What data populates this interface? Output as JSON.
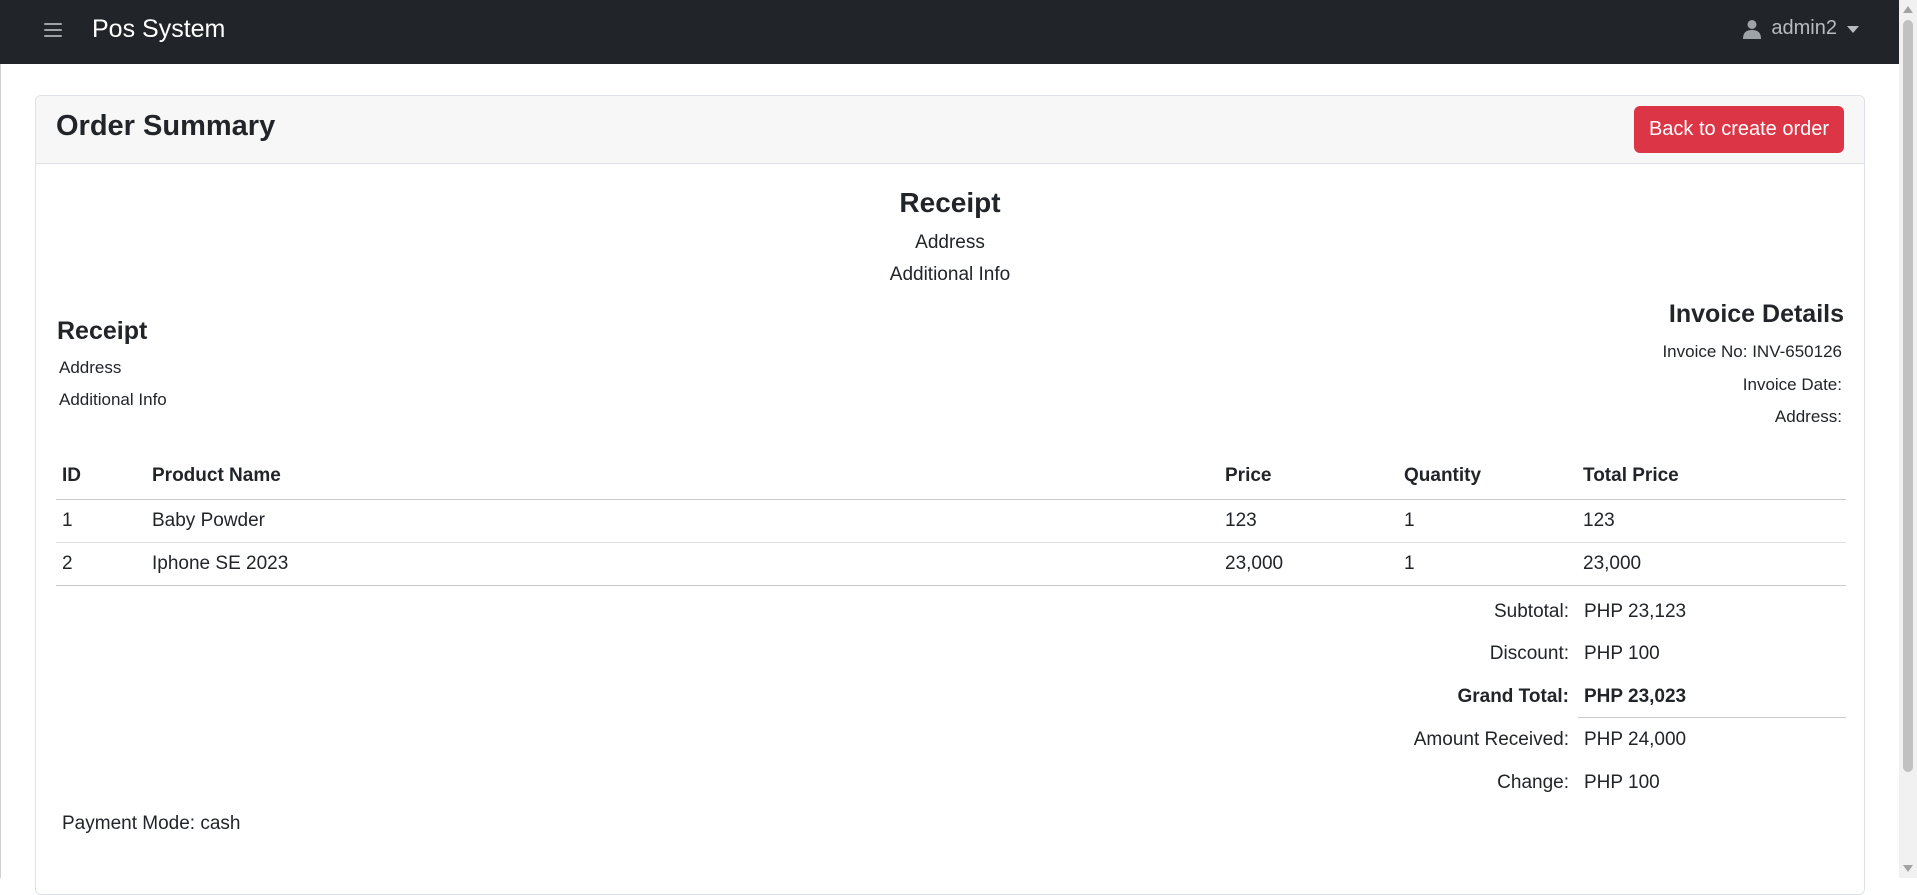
{
  "nav": {
    "brand": "Pos System",
    "user": "admin2"
  },
  "card": {
    "title": "Order Summary",
    "back_button": "Back to create order"
  },
  "receipt_center": {
    "title": "Receipt",
    "address": "Address",
    "info": "Additional Info"
  },
  "receipt_left": {
    "title": "Receipt",
    "address": "Address",
    "info": "Additional Info"
  },
  "invoice": {
    "title": "Invoice Details",
    "number": "Invoice No: INV-650126",
    "date": "Invoice Date:",
    "address": "Address:"
  },
  "table": {
    "headers": [
      "ID",
      "Product Name",
      "Price",
      "Quantity",
      "Total Price"
    ],
    "rows": [
      [
        "1",
        "Baby Powder",
        "123",
        "1",
        "123"
      ],
      [
        "2",
        "Iphone SE 2023",
        "23,000",
        "1",
        "23,000"
      ]
    ]
  },
  "totals": {
    "subtotal_label": "Subtotal:",
    "subtotal_value": "PHP 23,123",
    "discount_label": "Discount:",
    "discount_value": "PHP 100",
    "grand_label": "Grand Total:",
    "grand_value": "PHP 23,023",
    "received_label": "Amount Received:",
    "received_value": "PHP 24,000",
    "change_label": "Change:",
    "change_value": "PHP 100"
  },
  "payment_mode": "Payment Mode: cash",
  "colors": {
    "navbar": "#212529",
    "danger": "#dc3545"
  },
  "icons": [
    "hamburger-menu-icon",
    "user-icon",
    "caret-down-icon"
  ]
}
